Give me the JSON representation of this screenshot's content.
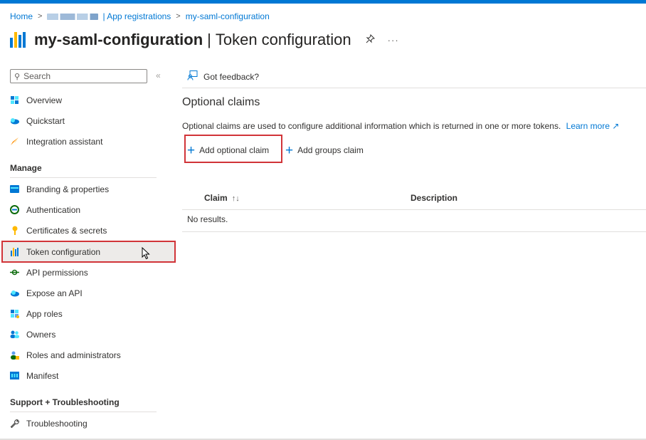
{
  "colors": {
    "accent": "#0078d4",
    "highlight_border": "#d13438"
  },
  "breadcrumb": {
    "home": "Home",
    "tenant_suffix": "| App registrations",
    "current": "my-saml-configuration"
  },
  "header": {
    "app_name": "my-saml-configuration",
    "separator": "|",
    "page_name": "Token configuration",
    "pin_icon": "pin-icon",
    "more_icon": "more-icon"
  },
  "sidebar": {
    "search_placeholder": "Search",
    "top_items": [
      {
        "label": "Overview",
        "icon": "overview-icon"
      },
      {
        "label": "Quickstart",
        "icon": "quickstart-icon"
      },
      {
        "label": "Integration assistant",
        "icon": "rocket-icon"
      }
    ],
    "manage_header": "Manage",
    "manage_items": [
      {
        "label": "Branding & properties",
        "icon": "branding-icon"
      },
      {
        "label": "Authentication",
        "icon": "authentication-icon"
      },
      {
        "label": "Certificates & secrets",
        "icon": "key-icon"
      },
      {
        "label": "Token configuration",
        "icon": "token-icon",
        "active": true
      },
      {
        "label": "API permissions",
        "icon": "api-permissions-icon"
      },
      {
        "label": "Expose an API",
        "icon": "cloud-icon"
      },
      {
        "label": "App roles",
        "icon": "app-roles-icon"
      },
      {
        "label": "Owners",
        "icon": "owners-icon"
      },
      {
        "label": "Roles and administrators",
        "icon": "roles-icon"
      },
      {
        "label": "Manifest",
        "icon": "manifest-icon"
      }
    ],
    "support_header": "Support + Troubleshooting",
    "support_items": [
      {
        "label": "Troubleshooting",
        "icon": "wrench-icon"
      }
    ]
  },
  "main": {
    "feedback": "Got feedback?",
    "heading": "Optional claims",
    "description": "Optional claims are used to configure additional information which is returned in one or more tokens.",
    "learn_more": "Learn more",
    "add_optional_claim": "Add optional claim",
    "add_groups_claim": "Add groups claim",
    "table": {
      "columns": [
        "Claim",
        "Description"
      ],
      "empty_text": "No results."
    }
  }
}
